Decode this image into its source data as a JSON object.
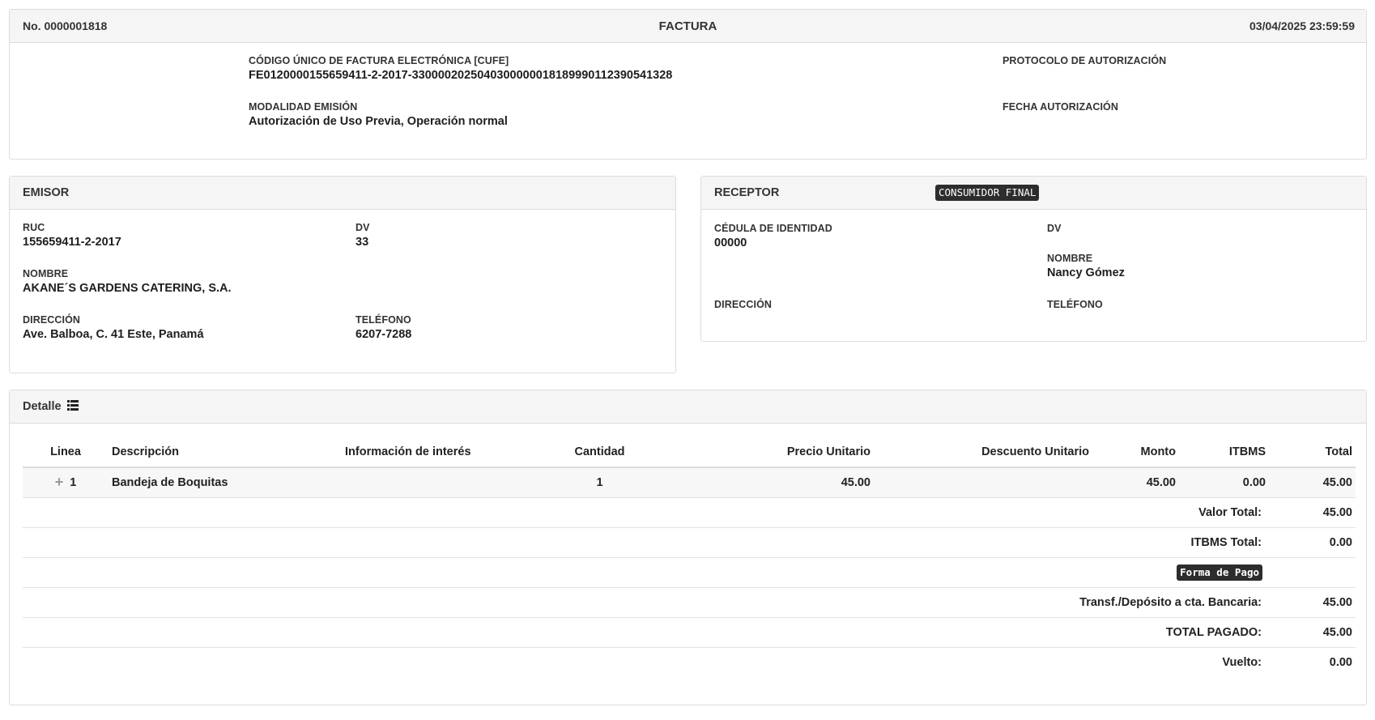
{
  "header": {
    "number": "No. 0000001818",
    "title": "FACTURA",
    "datetime": "03/04/2025 23:59:59",
    "cufe_label": "CÓDIGO ÚNICO DE FACTURA ELECTRÓNICA [CUFE]",
    "cufe_value": "FE0120000155659411-2-2017-330000202504030000001818999011239054132​8",
    "protocolo_label": "PROTOCOLO DE AUTORIZACIÓN",
    "protocolo_value": "",
    "modalidad_label": "MODALIDAD EMISIÓN",
    "modalidad_value": "Autorización de Uso Previa, Operación normal",
    "fecha_aut_label": "FECHA AUTORIZACIÓN",
    "fecha_aut_value": ""
  },
  "emisor": {
    "title": "EMISOR",
    "ruc_label": "RUC",
    "ruc_value": "155659411-2-2017",
    "dv_label": "DV",
    "dv_value": "33",
    "nombre_label": "NOMBRE",
    "nombre_value": "AKANE´S GARDENS CATERING, S.A.",
    "direccion_label": "DIRECCIÓN",
    "direccion_value": "Ave. Balboa, C. 41 Este, Panamá",
    "telefono_label": "TELÉFONO",
    "telefono_value": "6207-7288"
  },
  "receptor": {
    "title": "RECEPTOR",
    "badge": "CONSUMIDOR FINAL",
    "cedula_label": "CÉDULA DE IDENTIDAD",
    "cedula_value": "00000",
    "dv_label": "DV",
    "dv_value": "",
    "nombre_label": "NOMBRE",
    "nombre_value": "Nancy Gómez",
    "direccion_label": "DIRECCIÓN",
    "direccion_value": "",
    "telefono_label": "TELÉFONO",
    "telefono_value": ""
  },
  "detalle": {
    "title": "Detalle",
    "columns": [
      "Linea",
      "Descripción",
      "Información de interés",
      "Cantidad",
      "Precio Unitario",
      "Descuento Unitario",
      "Monto",
      "ITBMS",
      "Total"
    ],
    "items": [
      {
        "linea": "1",
        "descripcion": "Bandeja de Boquitas",
        "informacion": "",
        "cantidad": "1",
        "precio_unitario": "45.00",
        "descuento_unitario": "",
        "monto": "45.00",
        "itbms": "0.00",
        "total": "45.00"
      }
    ],
    "valor_total_label": "Valor Total:",
    "valor_total_value": "45.00",
    "itbms_total_label": "ITBMS Total:",
    "itbms_total_value": "0.00",
    "forma_pago_badge": "Forma de Pago",
    "transferencia_label": "Transf./Depósito a cta. Bancaria:",
    "transferencia_value": "45.00",
    "total_pagado_label": "TOTAL PAGADO:",
    "total_pagado_value": "45.00",
    "vuelto_label": "Vuelto:",
    "vuelto_value": "0.00"
  }
}
